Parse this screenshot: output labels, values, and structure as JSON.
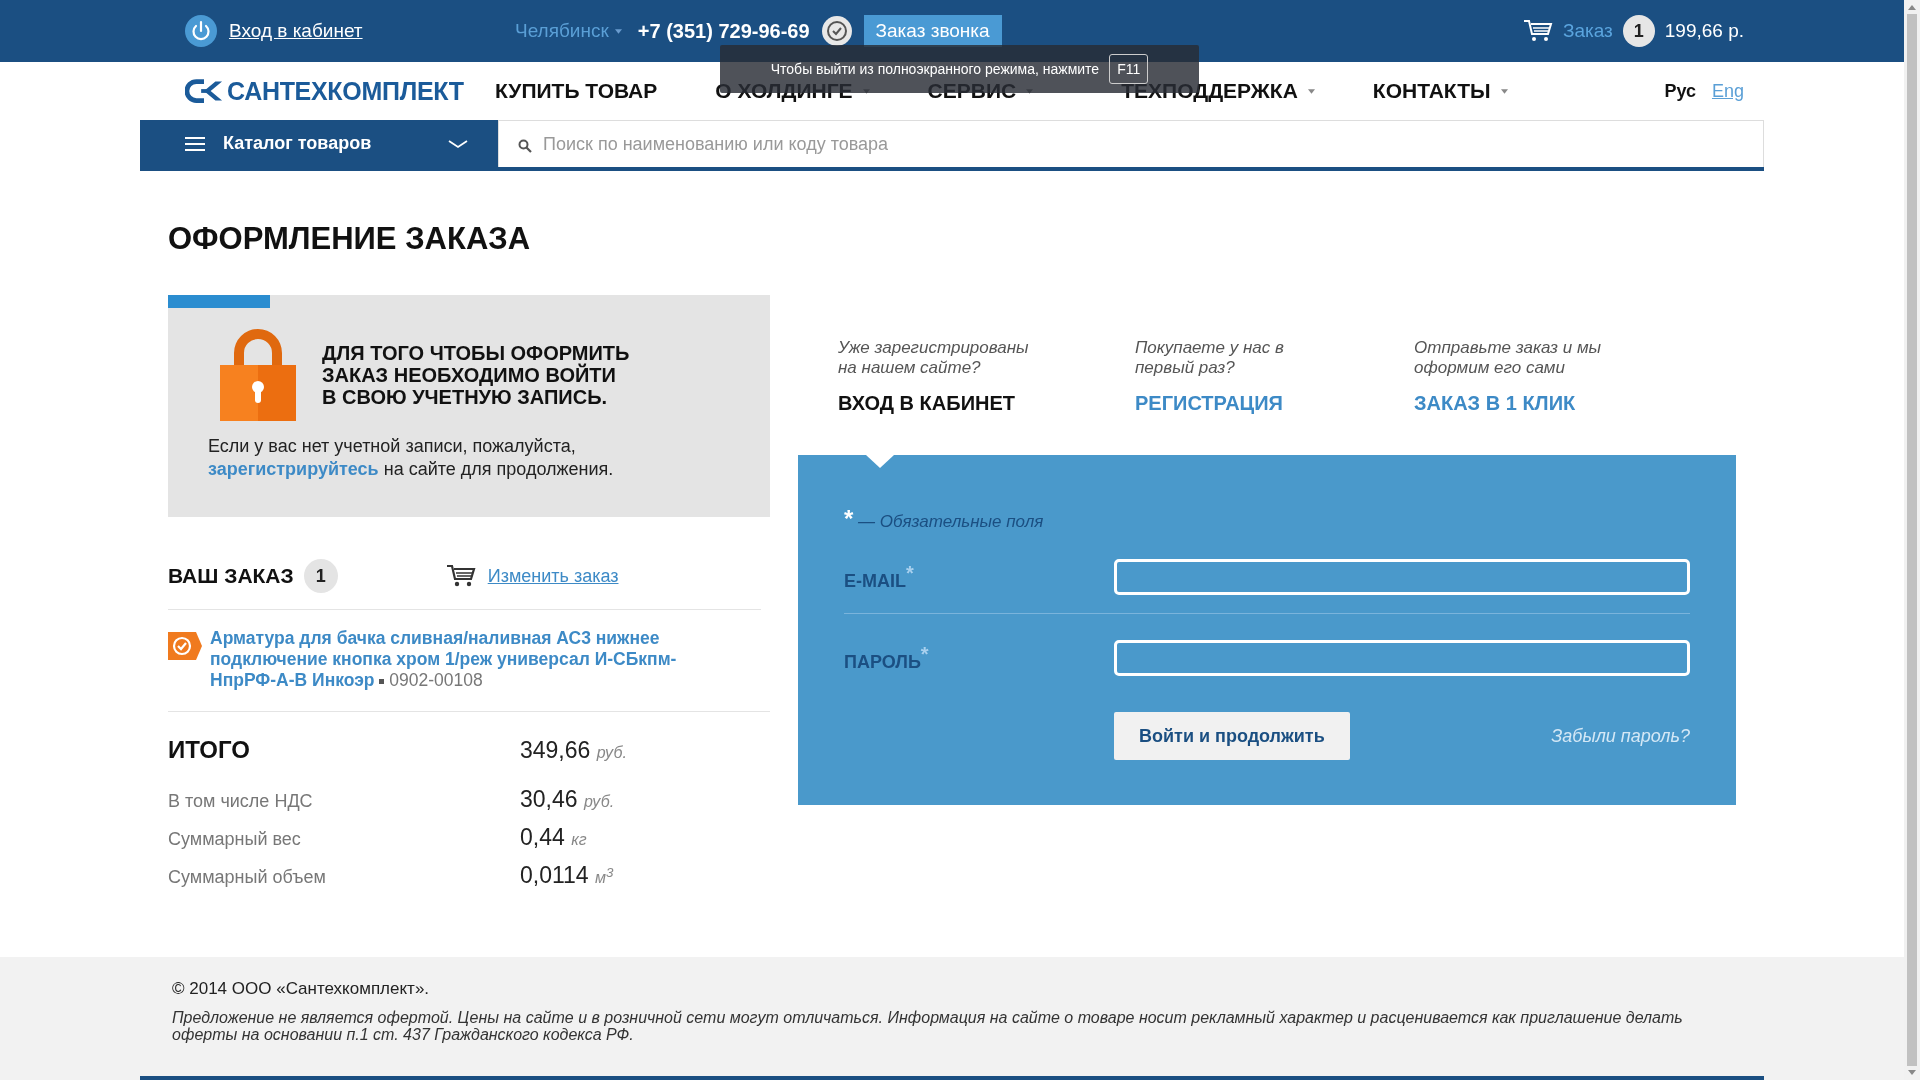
{
  "top_bar": {
    "login_link": "Вход в кабинет",
    "city": "Челябинск",
    "phone": "+7 (351) 729-96-69",
    "callback_button": "Заказ звонка",
    "cart": {
      "label": "Заказ",
      "count": "1",
      "total": "199,66 р."
    }
  },
  "fullscreen_notice": {
    "text": "Чтобы выйти из полноэкранного режима, нажмите",
    "key": "F11"
  },
  "nav": {
    "logo": "САНТЕХКОМПЛЕКТ",
    "items": [
      {
        "label": "КУПИТЬ ТОВАР",
        "has_dropdown": false
      },
      {
        "label": "О ХОЛДИНГЕ",
        "has_dropdown": true
      },
      {
        "label": "СЕРВИС",
        "has_dropdown": true
      },
      {
        "label": "ТЕХПОДДЕРЖКА",
        "has_dropdown": true
      },
      {
        "label": "КОНТАКТЫ",
        "has_dropdown": true
      }
    ],
    "languages": [
      {
        "label": "Рус",
        "selected": true
      },
      {
        "label": "Eng",
        "selected": false
      }
    ]
  },
  "catalog": {
    "label": "Каталог товаров"
  },
  "search": {
    "placeholder": "Поиск по наименованию или коду товара"
  },
  "page_title": "ОФОРМЛЕНИЕ ЗАКАЗА",
  "login_notice": {
    "heading": "ДЛЯ ТОГО ЧТОБЫ ОФОРМИТЬ ЗАКАЗ НЕОБХОДИМО ВОЙТИ В СВОЮ УЧЕТНУЮ ЗАПИСЬ.",
    "text_before": "Если у вас нет учетной записи, пожалуйста,",
    "link": "зарегистрируйтесь",
    "text_after": "на сайте для продолжения."
  },
  "order": {
    "title": "ВАШ ЗАКАЗ",
    "count": "1",
    "edit_link": "Изменить заказ",
    "items": [
      {
        "name": "Арматура для бачка сливная/наливная АС3 нижнее подключение кнопка хром 1/реж универсал И-СБкпм-НпрРФ-А-В Инкоэр",
        "code": "0902-00108"
      }
    ],
    "totals": [
      {
        "kind": "total",
        "label": "ИТОГО",
        "value": "349,66",
        "unit": "руб."
      },
      {
        "kind": "row",
        "label": "В том числе НДС",
        "value": "30,46",
        "unit": "руб."
      },
      {
        "kind": "row",
        "label": "Суммарный вес",
        "value": "0,44",
        "unit": "кг"
      },
      {
        "kind": "row",
        "label": "Суммарный объем",
        "value": "0,0114",
        "unit": "м$^{3}$"
      }
    ]
  },
  "auth_tabs": [
    {
      "hint": "Уже зарегистрированы на нашем сайте?",
      "label": "ВХОД В КАБИНЕТ",
      "selected": true
    },
    {
      "hint": "Покупаете у нас в первый раз?",
      "label": "РЕГИСТРАЦИЯ",
      "selected": false
    },
    {
      "hint": "Отправьте заказ и мы оформим его сами",
      "label": "ЗАКАЗ В 1 КЛИК",
      "selected": false
    }
  ],
  "form": {
    "required_mark": "*",
    "required_note": "— Обязательные поля",
    "fields": [
      {
        "label": "E-MAIL"
      },
      {
        "label": "ПАРОЛЬ"
      }
    ],
    "submit": "Войти и продолжить",
    "forgot": "Забыли пароль?"
  },
  "footer": {
    "copyright": "© 2014 ООО «Сантехкомплект».",
    "disclaimer": "Предложение не является офертой. Цены на сайте и в розничной сети могут отличаться. Информация на сайте о товаре носит рекламный характер и расценивается как приглашение делать оферты на основании п.1 ст. 437 Гражданского кодекса РФ."
  }
}
